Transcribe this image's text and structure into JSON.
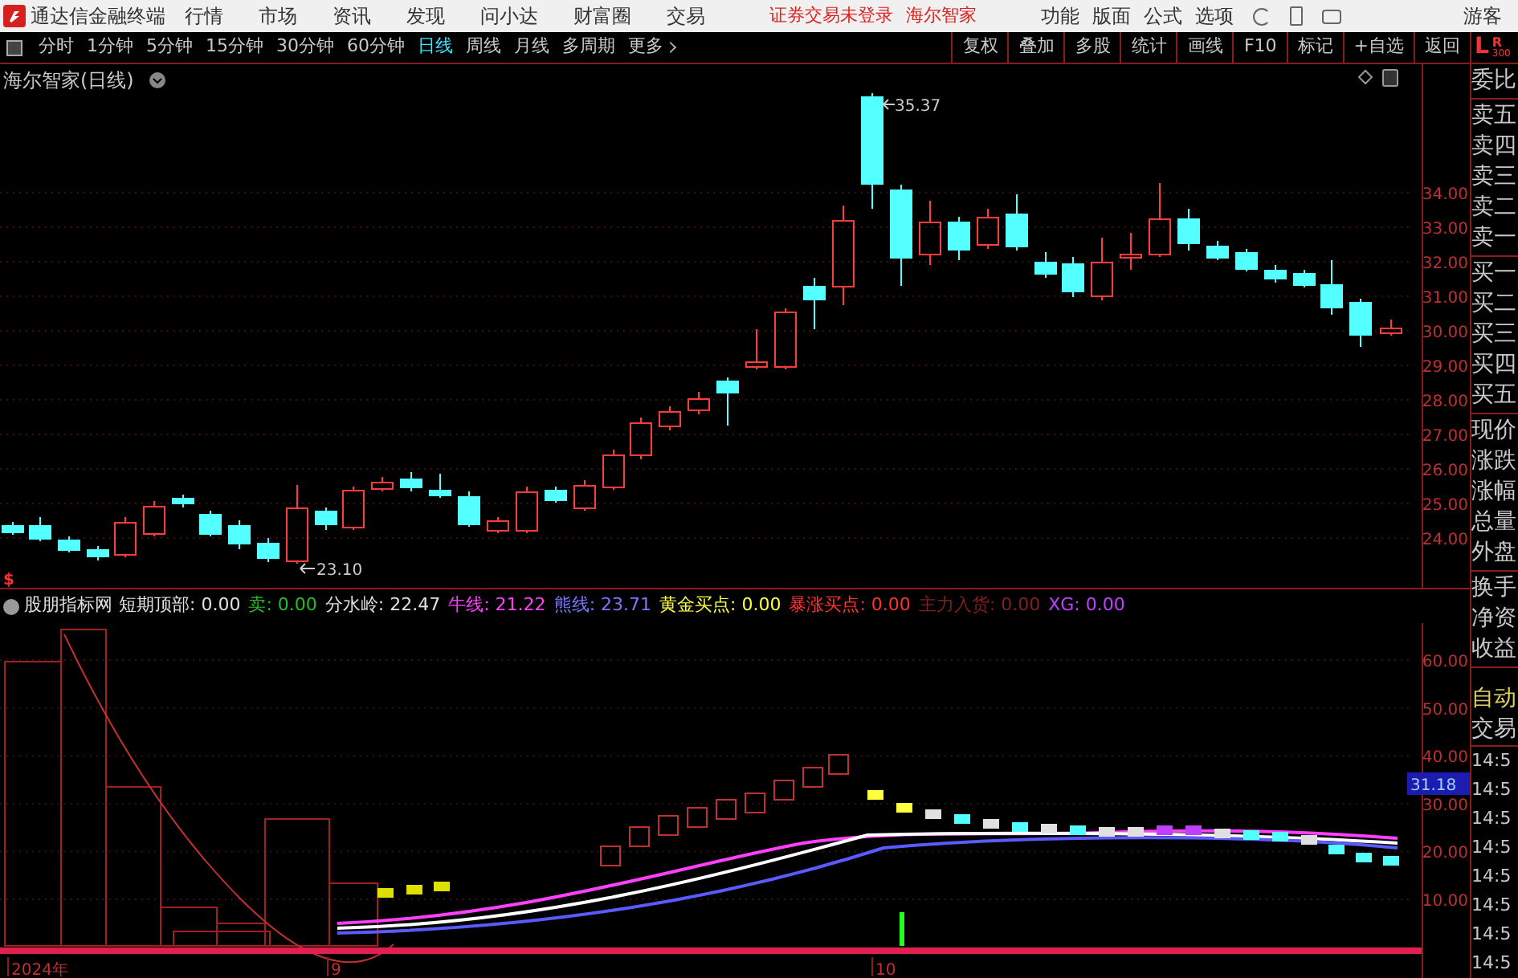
{
  "menu_bar": {
    "app_title": "通达信金融终端",
    "menus": [
      "行情",
      "市场",
      "资讯",
      "发现",
      "问小达",
      "财富圈",
      "交易"
    ],
    "login_status": "证券交易未登录",
    "stock_name": "海尔智家",
    "tools": [
      "功能",
      "版面",
      "公式",
      "选项"
    ],
    "user": "游客"
  },
  "period_bar": {
    "periods": [
      {
        "label": "分时",
        "selected": false
      },
      {
        "label": "1分钟",
        "selected": false
      },
      {
        "label": "5分钟",
        "selected": false
      },
      {
        "label": "15分钟",
        "selected": false
      },
      {
        "label": "30分钟",
        "selected": false
      },
      {
        "label": "60分钟",
        "selected": false
      },
      {
        "label": "日线",
        "selected": true
      },
      {
        "label": "周线",
        "selected": false
      },
      {
        "label": "月线",
        "selected": false
      },
      {
        "label": "多周期",
        "selected": false
      }
    ],
    "more": "更多",
    "actions": [
      "复权",
      "叠加",
      "多股",
      "统计",
      "画线",
      "F10",
      "标记",
      "+自选",
      "返回"
    ]
  },
  "price_chart": {
    "title": "海尔智家(日线)",
    "high_label": "35.37",
    "low_label": "23.10",
    "yticks": [
      "34.00",
      "33.00",
      "32.00",
      "31.00",
      "30.00",
      "29.00",
      "28.00",
      "27.00",
      "26.00",
      "25.00",
      "24.00"
    ]
  },
  "indicator": {
    "marker": "$",
    "name": "股朋指标网",
    "values": [
      {
        "label": "短期顶部:",
        "value": "0.00",
        "color": "#e0e0e0"
      },
      {
        "label": "卖:",
        "value": "0.00",
        "color": "#20c020"
      },
      {
        "label": "分水岭:",
        "value": "22.47",
        "color": "#e0e0e0"
      },
      {
        "label": "牛线:",
        "value": "21.22",
        "color": "#ff40ff"
      },
      {
        "label": "熊线:",
        "value": "23.71",
        "color": "#7878ff"
      },
      {
        "label": "黄金买点:",
        "value": "0.00",
        "color": "#ffff40"
      },
      {
        "label": "暴涨买点:",
        "value": "0.00",
        "color": "#ff3030"
      },
      {
        "label": "主力入货:",
        "value": "0.00",
        "color": "#802020"
      },
      {
        "label": "XG:",
        "value": "0.00",
        "color": "#c040ff"
      }
    ],
    "yticks": [
      "60.00",
      "50.00",
      "40.00",
      "30.00",
      "20.00",
      "10.00"
    ],
    "current_value": "31.18"
  },
  "date_axis": [
    "2024年",
    "9",
    "10"
  ],
  "quote_panel": {
    "header_main": "L",
    "header_sub": "R",
    "header_num": "300",
    "groups": [
      [
        "委比"
      ],
      [
        "卖五",
        "卖四",
        "卖三",
        "卖二",
        "卖一"
      ],
      [
        "买一",
        "买二",
        "买三",
        "买四",
        "买五"
      ],
      [
        "现价",
        "涨跌",
        "涨幅",
        "总量",
        "外盘"
      ],
      [
        "换手",
        "净资",
        "收益"
      ]
    ],
    "mode": "自动",
    "trade_label": "交易",
    "times": [
      "14:5",
      "14:5",
      "14:5",
      "14:5",
      "14:5",
      "14:5",
      "14:5",
      "14:5"
    ]
  }
}
